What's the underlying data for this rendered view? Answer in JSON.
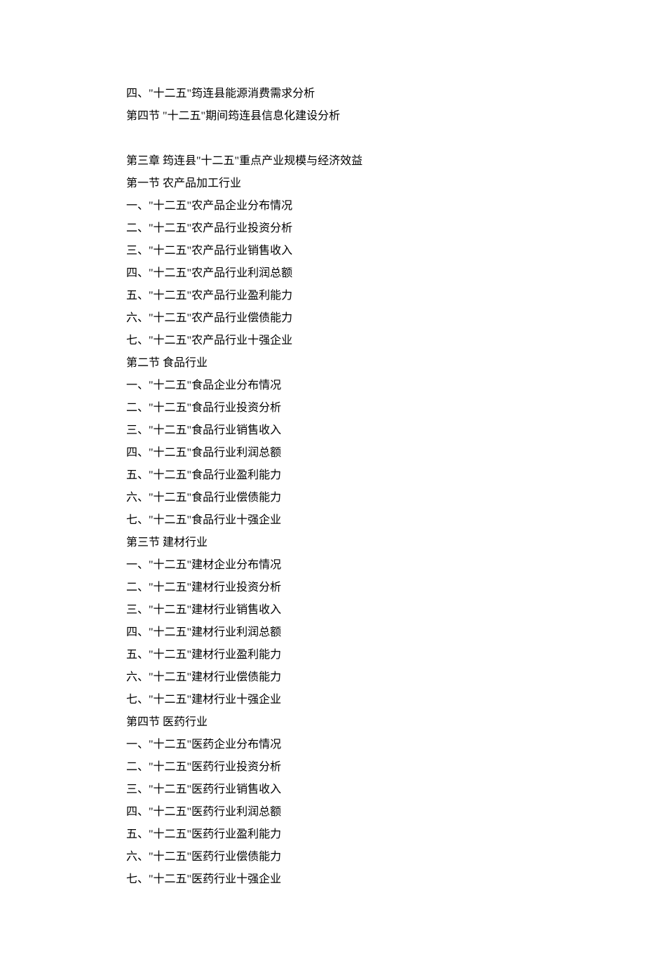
{
  "intro": [
    "四、\"十二五\"筠连县能源消费需求分析",
    "第四节  \"十二五\"期间筠连县信息化建设分析"
  ],
  "chapter3": {
    "title": "第三章  筠连县\"十二五\"重点产业规模与经济效益",
    "sections": [
      {
        "title": "第一节  农产品加工行业",
        "items": [
          "一、\"十二五\"农产品企业分布情况",
          "二、\"十二五\"农产品行业投资分析",
          "三、\"十二五\"农产品行业销售收入",
          "四、\"十二五\"农产品行业利润总额",
          "五、\"十二五\"农产品行业盈利能力",
          "六、\"十二五\"农产品行业偿债能力",
          "七、\"十二五\"农产品行业十强企业"
        ]
      },
      {
        "title": "第二节  食品行业",
        "items": [
          "一、\"十二五\"食品企业分布情况",
          "二、\"十二五\"食品行业投资分析",
          "三、\"十二五\"食品行业销售收入",
          "四、\"十二五\"食品行业利润总额",
          "五、\"十二五\"食品行业盈利能力",
          "六、\"十二五\"食品行业偿债能力",
          "七、\"十二五\"食品行业十强企业"
        ]
      },
      {
        "title": "第三节  建材行业",
        "items": [
          "一、\"十二五\"建材企业分布情况",
          "二、\"十二五\"建材行业投资分析",
          "三、\"十二五\"建材行业销售收入",
          "四、\"十二五\"建材行业利润总额",
          "五、\"十二五\"建材行业盈利能力",
          "六、\"十二五\"建材行业偿债能力",
          "七、\"十二五\"建材行业十强企业"
        ]
      },
      {
        "title": "第四节  医药行业",
        "items": [
          "一、\"十二五\"医药企业分布情况",
          "二、\"十二五\"医药行业投资分析",
          "三、\"十二五\"医药行业销售收入",
          "四、\"十二五\"医药行业利润总额",
          "五、\"十二五\"医药行业盈利能力",
          "六、\"十二五\"医药行业偿债能力",
          "七、\"十二五\"医药行业十强企业"
        ]
      }
    ]
  }
}
